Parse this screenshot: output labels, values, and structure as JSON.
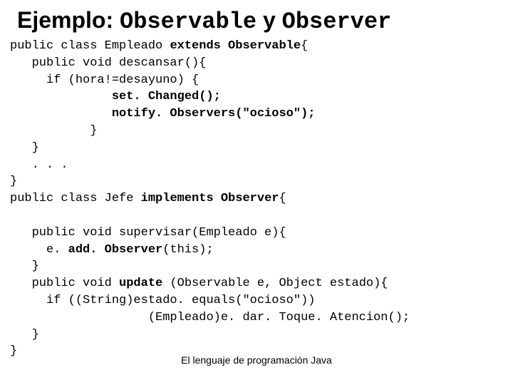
{
  "title": {
    "prefix": "Ejemplo:",
    "mono1": "Observable",
    "conj": "y",
    "mono2": "Observer"
  },
  "code": {
    "l1a": "public class Empleado ",
    "l1b": "extends Observable",
    "l1c": "{",
    "l2": "   public void descansar(){",
    "l3": "     if (hora!=desayuno) {",
    "l4": "              set. Changed();",
    "l5": "              notify. Observers(\"ocioso\");",
    "l6": "           }",
    "l7": "   }",
    "l8": "   . . .",
    "l9": "}",
    "l10a": "public class Jefe ",
    "l10b": "implements Observer",
    "l10c": "{",
    "blank": "",
    "l11": "   public void supervisar(Empleado e){",
    "l12a": "     e. ",
    "l12b": "add. Observer",
    "l12c": "(this);",
    "l13": "   }",
    "l14a": "   public void ",
    "l14b": "update",
    "l14c": " (Observable e, Object estado){",
    "l15": "     if ((String)estado. equals(\"ocioso\"))",
    "l16": "                   (Empleado)e. dar. Toque. Atencion();",
    "l17": "   }",
    "l18": "}"
  },
  "footer": "El lenguaje de programación Java"
}
